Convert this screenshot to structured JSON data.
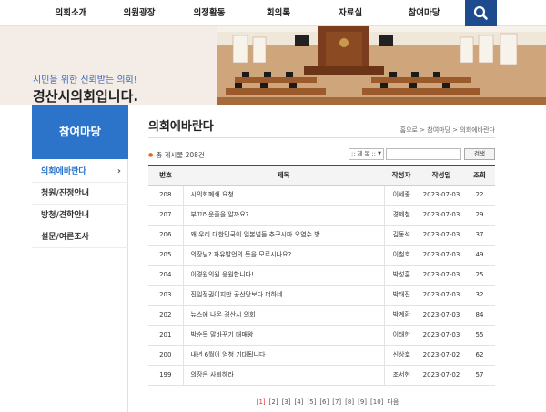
{
  "nav": {
    "items": [
      "의회소개",
      "의원광장",
      "의정활동",
      "회의록",
      "자료실",
      "참여마당"
    ]
  },
  "banner": {
    "slogan": "시민을 위한 신뢰받는 의회!",
    "title": "경산시의회입니다."
  },
  "sidebar": {
    "title": "참여마당",
    "items": [
      "의회에바란다",
      "청원/진정안내",
      "방청/견학안내",
      "설문/여론조사"
    ],
    "active_index": 0
  },
  "main": {
    "title": "의회에바란다",
    "breadcrumb": "홈으로 > 참여마당 > 의회에바란다",
    "count_text": "총 게시물 208건",
    "search_select": ":: 제 목 ::",
    "search_button": "검색",
    "table": {
      "headers": [
        "번호",
        "제목",
        "작성자",
        "작성일",
        "조회"
      ],
      "rows": [
        [
          "208",
          "시의회폐쇄 요청",
          "이세종",
          "2023-07-03",
          "22"
        ],
        [
          "207",
          "부끄러운줄을 알까요?",
          "경제철",
          "2023-07-03",
          "29"
        ],
        [
          "206",
          "왜 우리 대한민국이 일본넘들 추구시마 오염수 방...",
          "김동석",
          "2023-07-03",
          "37"
        ],
        [
          "205",
          "의장님? 자유발언의 뜻을 모르시나요?",
          "이철호",
          "2023-07-03",
          "49"
        ],
        [
          "204",
          "이경원의원 응원합니다!",
          "박성훈",
          "2023-07-03",
          "25"
        ],
        [
          "203",
          "진일정권이지만 공산당보다 더하네",
          "박태진",
          "2023-07-03",
          "32"
        ],
        [
          "202",
          "뉴스에 나온 경산시 의회",
          "박계환",
          "2023-07-03",
          "84"
        ],
        [
          "201",
          "박순득 말바꾸기 대매왕",
          "이태한",
          "2023-07-03",
          "55"
        ],
        [
          "200",
          "내년 6월이 엄청 기대됩니다",
          "신상호",
          "2023-07-02",
          "62"
        ],
        [
          "199",
          "의장은 사퇴하라",
          "조서현",
          "2023-07-02",
          "57"
        ]
      ]
    },
    "pagination": {
      "pages": [
        "[1]",
        "[2]",
        "[3]",
        "[4]",
        "[5]",
        "[6]",
        "[7]",
        "[8]",
        "[9]",
        "[10]"
      ],
      "next": "다음",
      "current_index": 0
    }
  },
  "colors": {
    "accent": "#2b74c9",
    "nav_search": "#1e4a8e",
    "banner_bg": "#f4ede7",
    "count_dot": "#e26b1c",
    "current_page": "#dd3333"
  },
  "icons": {
    "search": "search-icon",
    "chevron": "chevron-right-icon"
  }
}
